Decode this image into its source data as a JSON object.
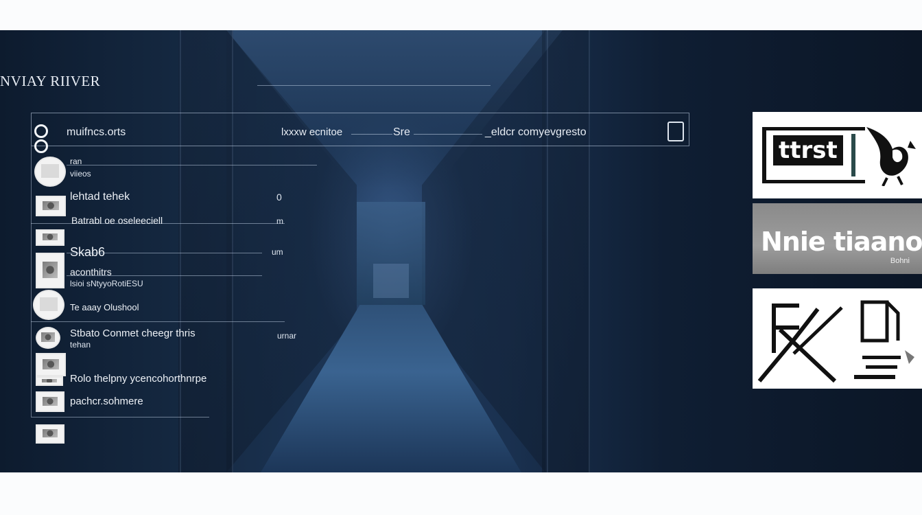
{
  "window": {
    "title": "NVIAY RIIVER"
  },
  "header": {
    "left_label": "muifncs.orts",
    "mid_label": "lxxxw ecnitoe",
    "mid_short": "Sre",
    "right_label": "_eldcr comyevgresto"
  },
  "list": {
    "items": [
      {
        "label": "ran",
        "sub": "viieos",
        "value": ""
      },
      {
        "label": "lehtad tehek",
        "sub": "",
        "value": "0"
      },
      {
        "label": "Batrabl oe oseleeciell",
        "sub": "",
        "value": "m"
      },
      {
        "label": "Skab6",
        "sub": "",
        "value": "um"
      },
      {
        "label": "aconthitrs",
        "sub": "lsioi sNtyyoRotiESU",
        "value": ""
      },
      {
        "label": "Te aaay Olushool",
        "sub": "",
        "value": ""
      },
      {
        "label": "Stbato Conmet cheegr thris",
        "sub": "tehan",
        "value": "urnar"
      },
      {
        "label": "Rolo thelpny ycencohorthnrpe",
        "sub": "",
        "value": ""
      },
      {
        "label": "pachcr.sohmere",
        "sub": "",
        "value": ""
      }
    ]
  },
  "cards": {
    "card1_text": "ttrst",
    "card2_text": "Nnie tiaano",
    "card2_sub": "Bohni"
  }
}
